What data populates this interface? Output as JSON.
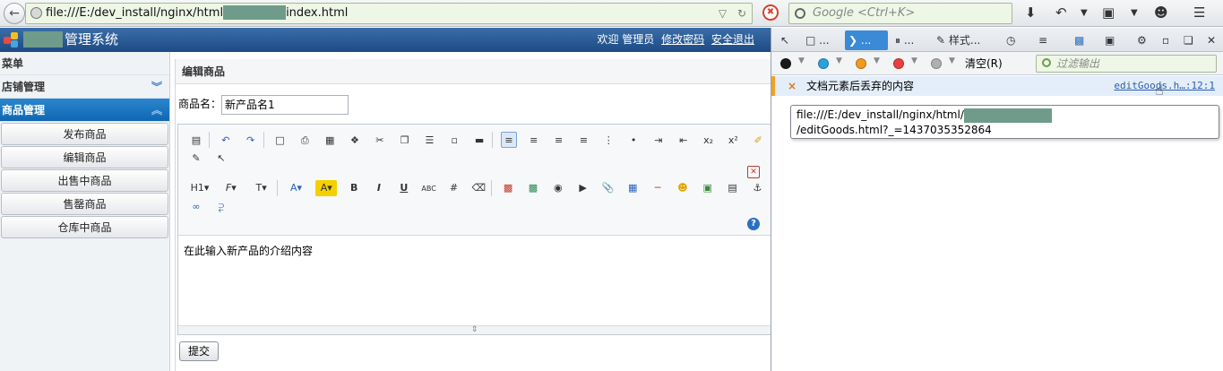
{
  "browser": {
    "url_prefix": "file:///E:/dev_install/nginx/html",
    "url_suffix": "index.html",
    "search_placeholder": "Google <Ctrl+K>"
  },
  "header": {
    "app_title": "管理系统",
    "welcome": "欢迎 管理员",
    "change_password": "修改密码",
    "logout": "安全退出"
  },
  "sidebar": {
    "title": "菜单",
    "groups": [
      {
        "label": "店铺管理",
        "chevron": "︾"
      },
      {
        "label": "商品管理",
        "chevron": "︽"
      }
    ],
    "items": [
      "发布商品",
      "编辑商品",
      "出售中商品",
      "售罄商品",
      "仓库中商品"
    ]
  },
  "content": {
    "panel_title": "编辑商品",
    "name_label": "商品名：",
    "name_value": "新产品名1",
    "editor_text": "在此输入新产品的介绍内容",
    "submit_label": "提交"
  },
  "devtools": {
    "tab_console": "...",
    "tab_debugger": "...",
    "tab_style": "样式...",
    "clear_label": "清空(R)",
    "filter_placeholder": "过滤输出",
    "log_message": "文档元素后丢弃的内容",
    "log_source": "editGoods.h…:12:1",
    "tooltip_line1": "file:///E:/dev_install/nginx/html/",
    "tooltip_line2": "/editGoods.html?_=1437035352864",
    "dot_colors": [
      "#1a1a1a",
      "#2aa3dd",
      "#f29a1e",
      "#e8403b",
      "#b0b0b0"
    ]
  }
}
